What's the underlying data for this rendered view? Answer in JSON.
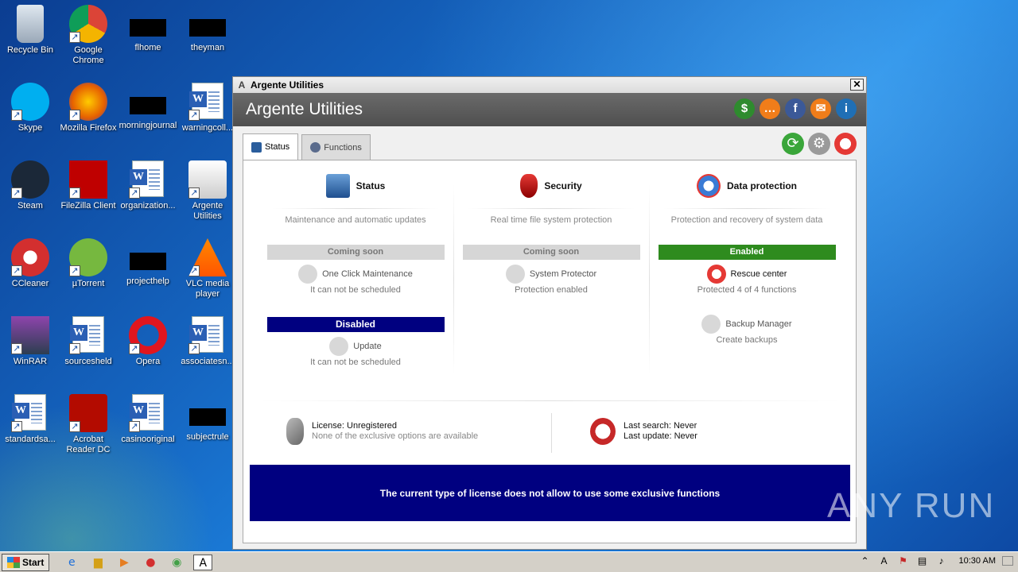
{
  "desktop": {
    "icons": [
      {
        "label": "Recycle Bin",
        "icon": "recycle-bin-icon"
      },
      {
        "label": "Google Chrome",
        "icon": "chrome-icon"
      },
      {
        "label": "flhome",
        "icon": "file-icon"
      },
      {
        "label": "theyman",
        "icon": "file-icon"
      },
      {
        "label": "Skype",
        "icon": "skype-icon"
      },
      {
        "label": "Mozilla Firefox",
        "icon": "firefox-icon"
      },
      {
        "label": "morningjournal",
        "icon": "file-icon"
      },
      {
        "label": "warningcoll...",
        "icon": "word-doc-icon"
      },
      {
        "label": "Steam",
        "icon": "steam-icon"
      },
      {
        "label": "FileZilla Client",
        "icon": "filezilla-icon"
      },
      {
        "label": "organization...",
        "icon": "word-doc-icon"
      },
      {
        "label": "Argente Utilities",
        "icon": "argente-icon"
      },
      {
        "label": "CCleaner",
        "icon": "ccleaner-icon"
      },
      {
        "label": "µTorrent",
        "icon": "utorrent-icon"
      },
      {
        "label": "projecthelp",
        "icon": "file-icon"
      },
      {
        "label": "VLC media player",
        "icon": "vlc-icon"
      },
      {
        "label": "WinRAR",
        "icon": "winrar-icon"
      },
      {
        "label": "sourcesheld",
        "icon": "word-doc-icon"
      },
      {
        "label": "Opera",
        "icon": "opera-icon"
      },
      {
        "label": "associatesn...",
        "icon": "word-doc-icon"
      },
      {
        "label": "standardsa...",
        "icon": "word-doc-icon"
      },
      {
        "label": "Acrobat Reader DC",
        "icon": "acrobat-icon"
      },
      {
        "label": "casinooriginal",
        "icon": "word-doc-icon"
      },
      {
        "label": "subjectrule",
        "icon": "file-icon"
      }
    ]
  },
  "window": {
    "title": "Argente Utilities",
    "header_title": "Argente Utilities",
    "close_glyph": "✕",
    "tabs": [
      {
        "label": "Status",
        "active": true
      },
      {
        "label": "Functions",
        "active": false
      }
    ],
    "columns": [
      {
        "title": "Status",
        "subtitle": "Maintenance and automatic updates",
        "sections": [
          {
            "badge": "Coming soon",
            "feature": "One Click Maintenance",
            "note": "It can not be scheduled"
          },
          {
            "badge": "Disabled",
            "feature": "Update",
            "note": "It can not be scheduled"
          }
        ]
      },
      {
        "title": "Security",
        "subtitle": "Real time file system protection",
        "sections": [
          {
            "badge": "Coming soon",
            "feature": "System Protector",
            "note": "Protection enabled"
          }
        ]
      },
      {
        "title": "Data protection",
        "subtitle": "Protection and recovery of system data",
        "sections": [
          {
            "badge": "Enabled",
            "feature": "Rescue center",
            "note": "Protected 4 of 4 functions"
          },
          {
            "badge": "",
            "feature": "Backup Manager",
            "note": "Create backups"
          }
        ]
      }
    ],
    "license": {
      "line1": "License: Unregistered",
      "line2": "None of the exclusive options are available"
    },
    "search": {
      "line1": "Last search: Never",
      "line2": "Last update: Never"
    },
    "banner": "The current type of license does not allow to use some exclusive functions",
    "header_buttons": [
      {
        "glyph": "$",
        "icon": "dollar-icon",
        "color": "#2e8b2e"
      },
      {
        "glyph": "…",
        "icon": "chat-icon",
        "color": "#f07d1a"
      },
      {
        "glyph": "f",
        "icon": "facebook-icon",
        "color": "#3b5998"
      },
      {
        "glyph": "✉",
        "icon": "mail-icon",
        "color": "#f07d1a"
      },
      {
        "glyph": "i",
        "icon": "info-icon",
        "color": "#1f6fb5"
      }
    ]
  },
  "watermark": {
    "text": "ANY RUN"
  },
  "taskbar": {
    "start_label": "Start",
    "clock": "10:30 AM"
  },
  "colors": {
    "enabled_green": "#2e8b1e",
    "navy": "#000080",
    "coming_soon_gray": "#d6d6d6"
  }
}
